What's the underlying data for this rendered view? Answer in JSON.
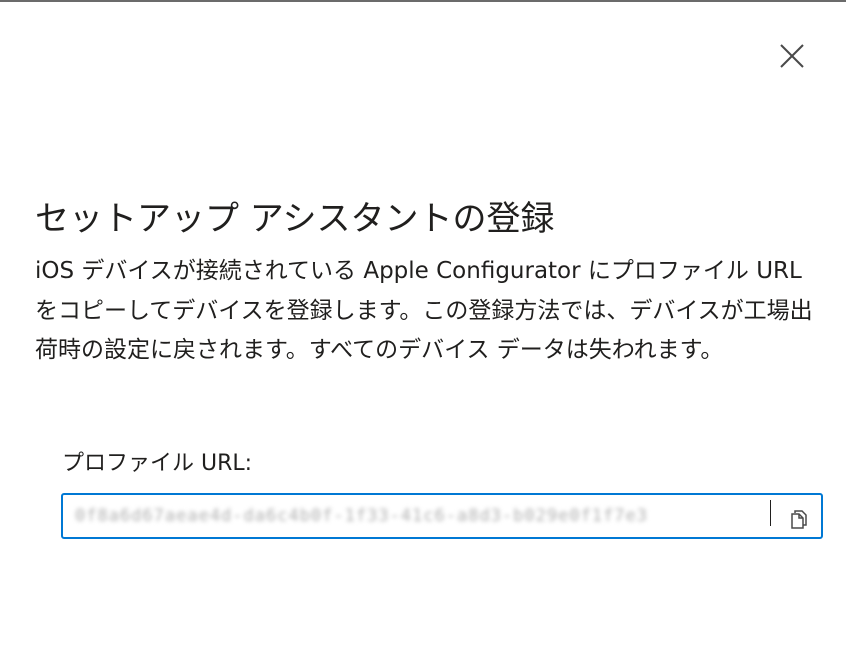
{
  "dialog": {
    "close_icon": "close-icon",
    "title": "セットアップ アシスタントの登録",
    "description": "iOS デバイスが接続されている Apple Configurator にプロファイル URL をコピーしてデバイスを登録します。この登録方法では、デバイスが工場出荷時の設定に戻されます。すべてのデバイス データは失われます。",
    "profile_url": {
      "label": "プロファイル URL:",
      "value": "0f8a6d67aeae4d-da6c4b0f-1f33-41c6-a8d3-b029e0f1f7e3",
      "copy_icon": "copy-icon"
    }
  },
  "colors": {
    "accent": "#0078d4",
    "text": "#201f1e",
    "background": "#ffffff"
  }
}
